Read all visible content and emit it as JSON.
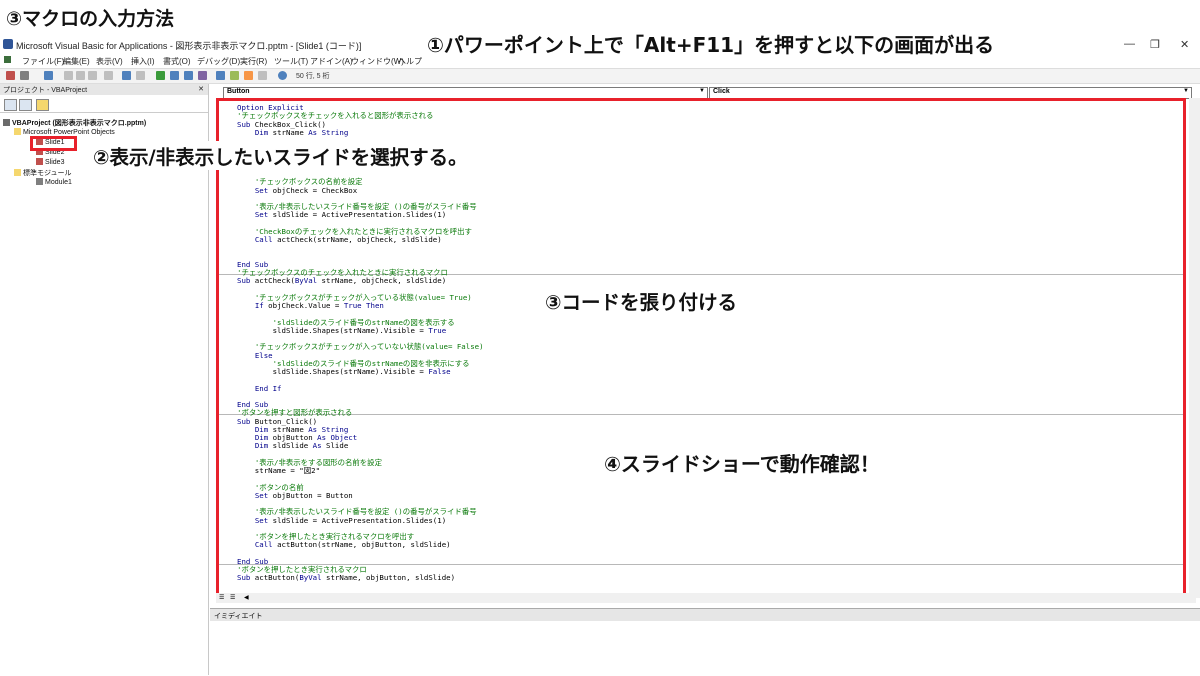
{
  "heading": "③マクロの入力方法",
  "window": {
    "title": "Microsoft Visual Basic for Applications - 図形表示非表示マクロ.pptm - [Slide1 (コード)]",
    "controls": [
      "—",
      "❐",
      "✕"
    ]
  },
  "menu": [
    "ファイル(F)",
    "編集(E)",
    "表示(V)",
    "挿入(I)",
    "書式(O)",
    "デバッグ(D)",
    "実行(R)",
    "ツール(T)",
    "アドイン(A)",
    "ウィンドウ(W)",
    "ヘルプ"
  ],
  "toolbar": {
    "position": "50 行, 5 桁"
  },
  "project": {
    "title": "プロジェクト - VBAProject",
    "close": "✕",
    "root": "VBAProject (図形表示非表示マクロ.pptm)",
    "folder_objects": "Microsoft PowerPoint Objects",
    "slides": [
      "Slide1",
      "Slide2",
      "Slide3"
    ],
    "folder_modules": "標準モジュール",
    "module": "Module1"
  },
  "code": {
    "object_combo": "Button",
    "proc_combo": "Click"
  },
  "immediate": {
    "title": "イミディエイト"
  },
  "annotations": {
    "step1": "①パワーポイント上で「Alt+F11」を押すと以下の画面が出る",
    "step2": "②表示/非表示したいスライドを選択する。",
    "step3": "③コードを張り付ける",
    "step4": "④スライドショーで動作確認！"
  },
  "colors": {
    "highlight": "#e8212b",
    "keyword": "#00008b",
    "comment": "#0a7a0a"
  }
}
